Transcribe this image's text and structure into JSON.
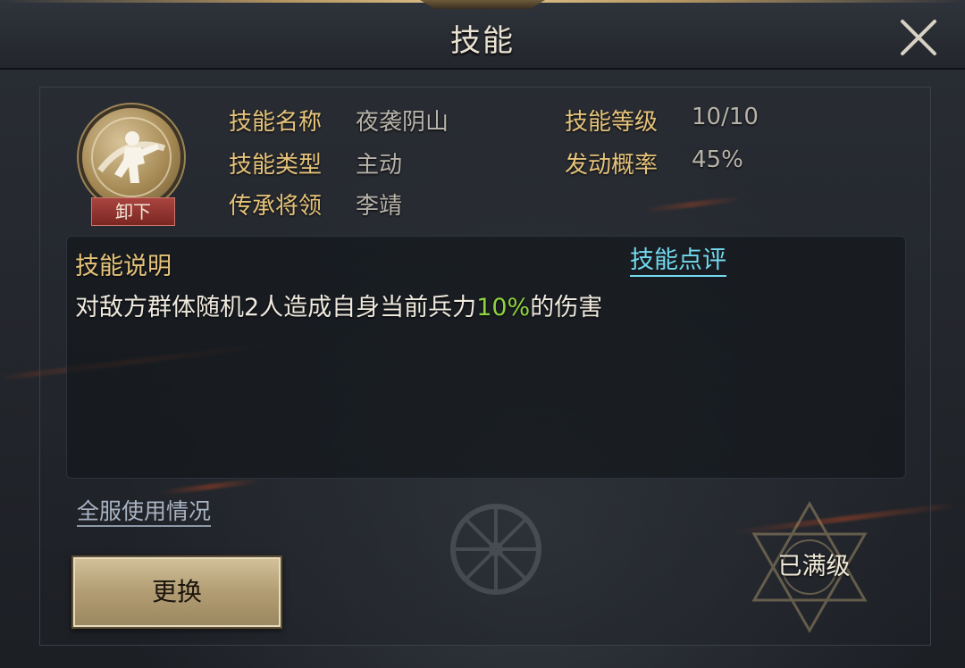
{
  "window": {
    "title": "技能",
    "close_icon": "close-icon"
  },
  "skill": {
    "icon": "warrior-skill-icon",
    "unequip_label": "卸下",
    "fields": {
      "name_label": "技能名称",
      "name_value": "夜袭阴山",
      "type_label": "技能类型",
      "type_value": "主动",
      "inherit_label": "传承将领",
      "inherit_value": "李靖",
      "level_label": "技能等级",
      "level_value": "10/10",
      "chance_label": "发动概率",
      "chance_value": "45%"
    }
  },
  "description": {
    "header": "技能说明",
    "review_link": "技能点评",
    "text_before": "对敌方群体随机2人造成自身当前兵力",
    "text_highlight": "10%",
    "text_after": "的伤害"
  },
  "footer": {
    "usage_link": "全服使用情况",
    "replace_button": "更换",
    "maxed_label": "已满级"
  },
  "colors": {
    "label_gold": "#e6c37a",
    "value_gray": "#b8b3aa",
    "link_cyan": "#72d8ee",
    "highlight_green": "#8ed23f",
    "unequip_red": "#a9453f"
  }
}
